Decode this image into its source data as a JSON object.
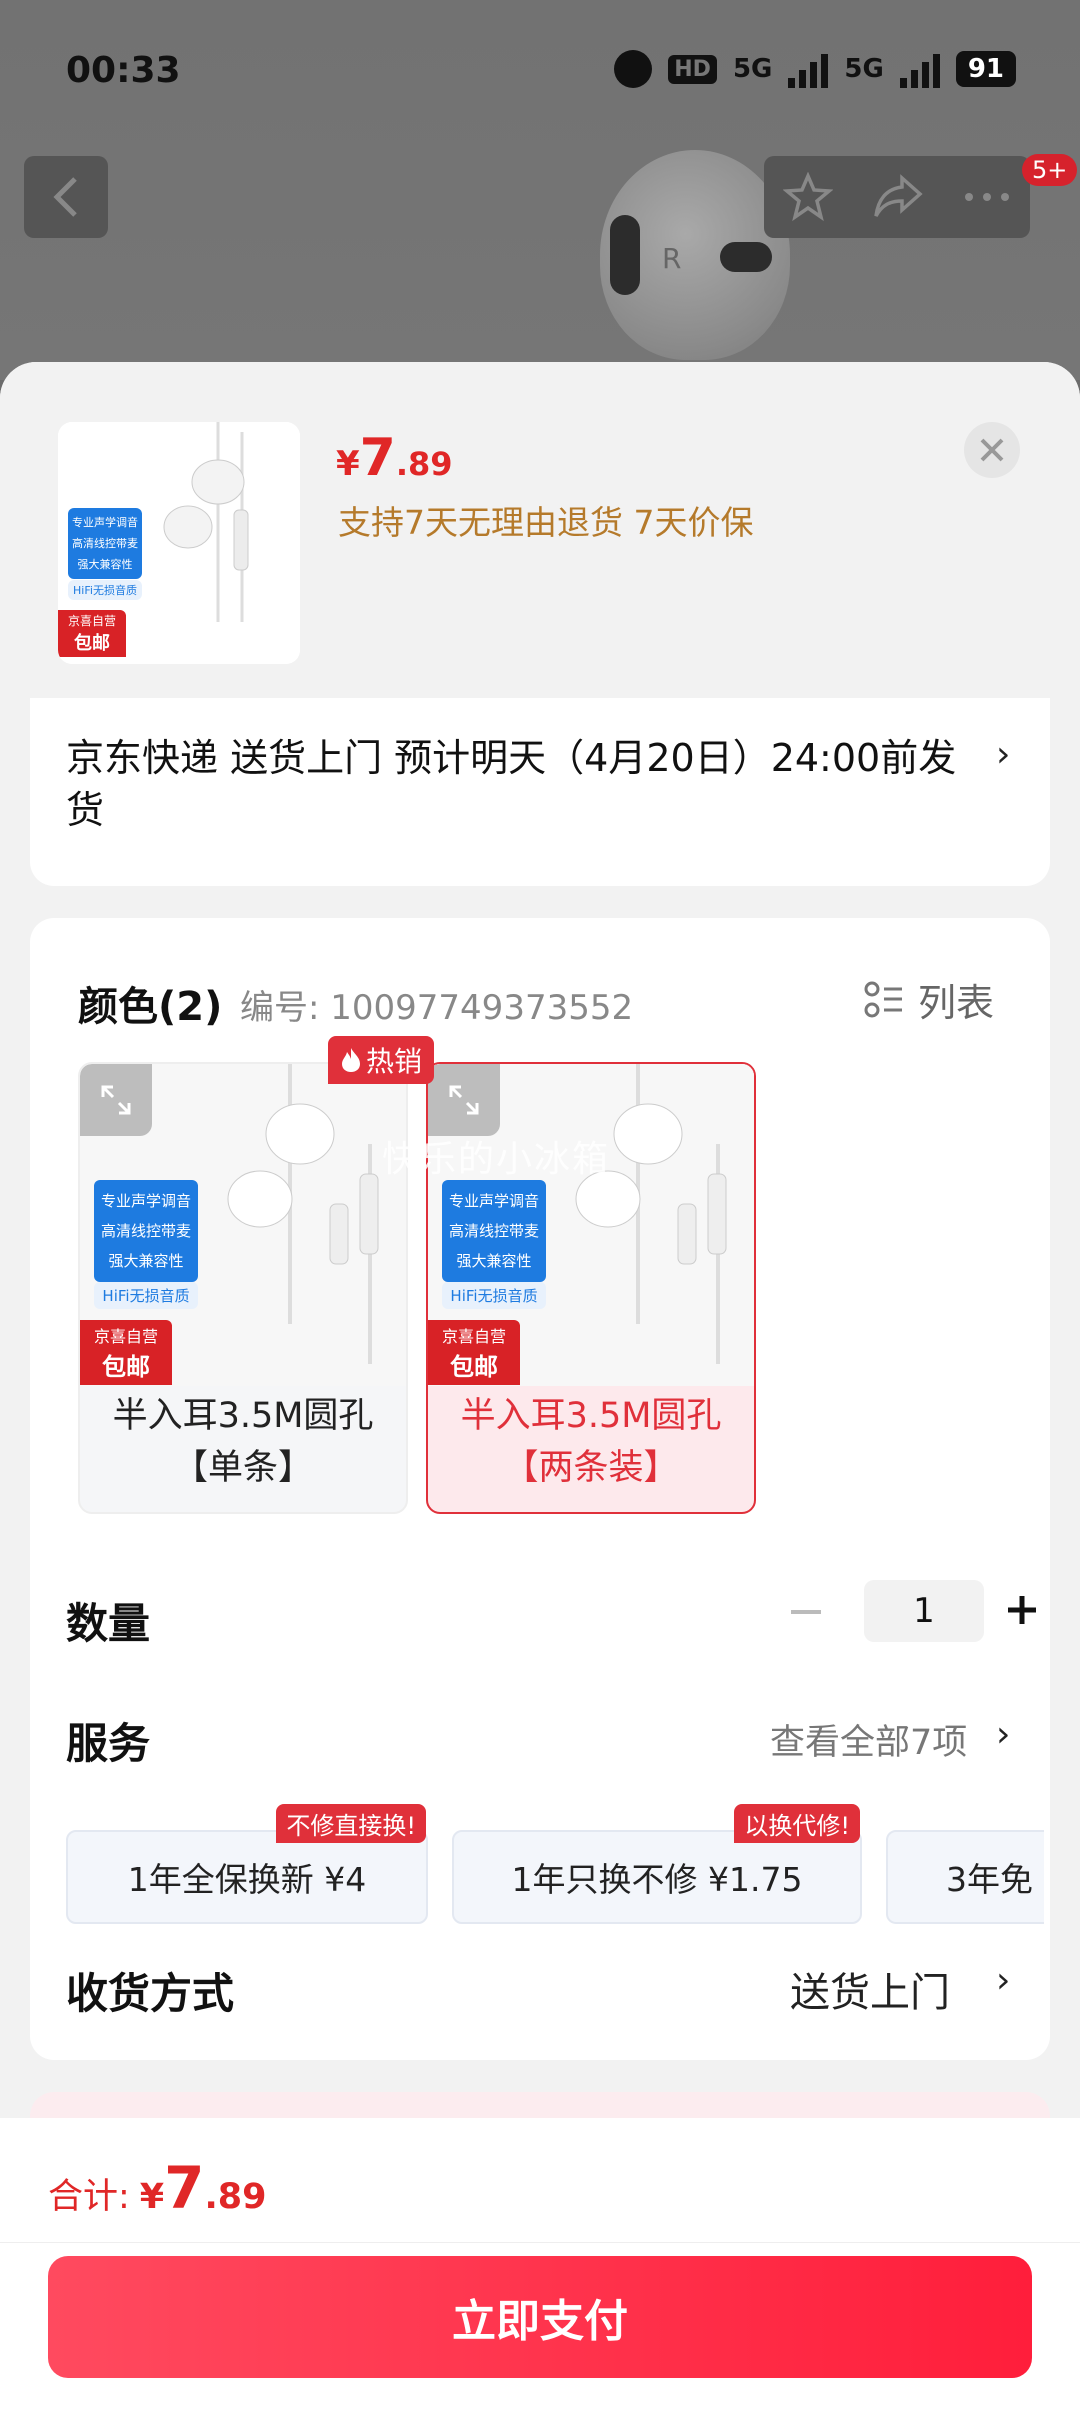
{
  "status": {
    "time": "00:33",
    "battery": "91",
    "hd": "HD",
    "net1": "5G",
    "net2": "5G"
  },
  "topbar": {
    "badge": "5+"
  },
  "product": {
    "price_currency": "¥",
    "price_int": "7",
    "price_dec": ".89",
    "promise": "支持7天无理由退货  7天价保",
    "thumb_tags": [
      "专业声学调音",
      "高清线控带麦",
      "强大兼容性",
      "HiFi无损音质"
    ],
    "thumb_brand": "京喜自营",
    "thumb_ship": "包邮"
  },
  "shipping": {
    "text": "京东快递 送货上门 预计明天（4月20日）24:00前发货"
  },
  "spec": {
    "title": "颜色(2)",
    "sku_label": "编号: 10097749373552",
    "list_label": "列表",
    "hot_label": "热销",
    "watermark": "快乐的小冰箱",
    "variants": [
      {
        "label": "半入耳3.5M圆孔【单条】",
        "selected": false
      },
      {
        "label": "半入耳3.5M圆孔【两条装】",
        "selected": true
      }
    ]
  },
  "quantity": {
    "label": "数量",
    "value": "1"
  },
  "service": {
    "label": "服务",
    "view_all": "查看全部7项",
    "chips": [
      {
        "label": "1年全保换新  ¥4",
        "tag": "不修直接换!"
      },
      {
        "label": "1年只换不修  ¥1.75",
        "tag": "以换代修!"
      },
      {
        "label": "3年免",
        "tag": ""
      }
    ]
  },
  "delivery": {
    "label": "收货方式",
    "value": "送货上门"
  },
  "footer": {
    "total_label": "合计:",
    "total_currency": "¥",
    "total_int": "7",
    "total_dec": ".89",
    "pay_label": "立即支付"
  },
  "colors": {
    "accent": "#e02727",
    "promise": "#b57a2b",
    "pay_start": "#ff4a5f",
    "pay_end": "#ff1e3b"
  }
}
